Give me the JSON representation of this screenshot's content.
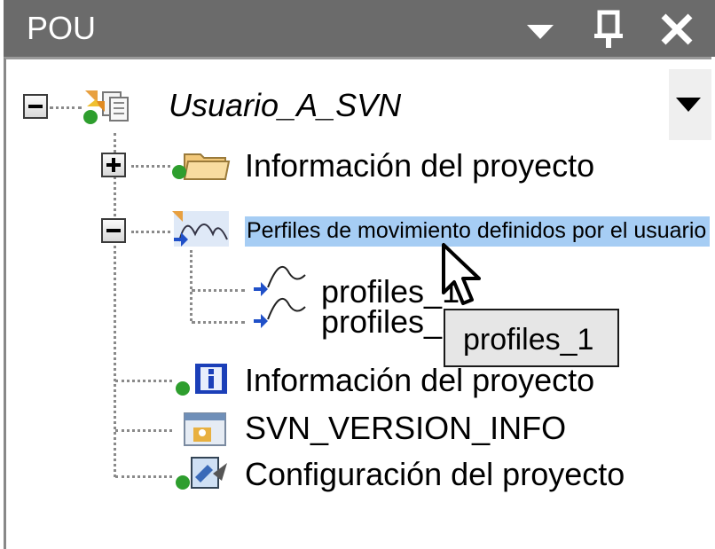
{
  "panel": {
    "title": "POU",
    "buttons": {
      "dropdown": "chevron-down-icon",
      "pin": "pin-icon",
      "close": "close-icon"
    }
  },
  "tree": {
    "root": {
      "label": "Usuario_A_SVN",
      "state": "expanded"
    },
    "items": [
      {
        "label": "Información del proyecto",
        "state": "collapsed"
      },
      {
        "label": "Perfiles de movimiento definidos por el usuario",
        "state": "expanded",
        "selected": true,
        "children": [
          {
            "label": "profiles_1"
          },
          {
            "label": "profiles_2"
          }
        ]
      },
      {
        "label": "Información del proyecto"
      },
      {
        "label": "SVN_VERSION_INFO"
      },
      {
        "label": "Configuración del proyecto"
      }
    ]
  },
  "tooltip": {
    "text": "profiles_1"
  },
  "colors": {
    "titlebar": "#6b6b6b",
    "selection": "#a6cdf4",
    "tooltip_bg": "#e6e6e6"
  }
}
